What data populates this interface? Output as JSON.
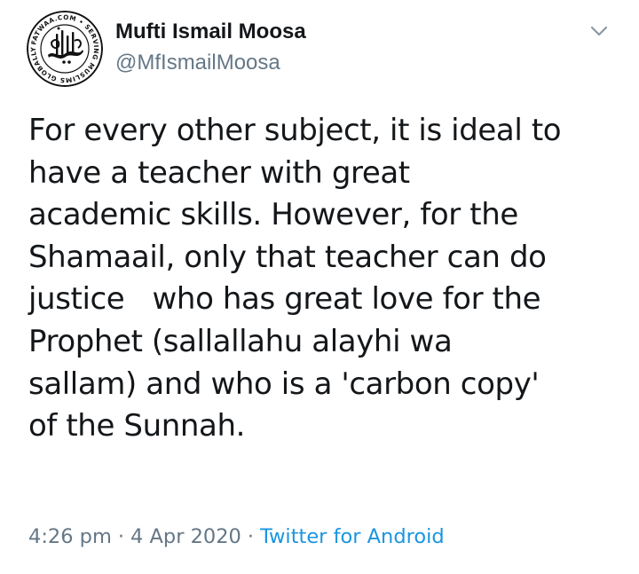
{
  "author": {
    "display_name": "Mufti Ismail Moosa",
    "handle": "@MfIsmailMoosa",
    "avatar_text": "FATWAA.COM • SERVING MUSLIMS GLOBALLY"
  },
  "tweet": {
    "text": "For every other subject, it is ideal to\nhave a teacher with great\nacademic skills. However, for the\nShamaail, only that teacher can do\njustice   who has great love for the\nProphet (sallallahu alayhi wa\nsallam) and who is a 'carbon copy'\nof the Sunnah."
  },
  "meta": {
    "time": "4:26 pm",
    "separator": "·",
    "date": "4 Apr 2020",
    "source": "Twitter for Android"
  },
  "icons": {
    "menu": "chevron-down-icon"
  },
  "colors": {
    "text_primary": "#14171a",
    "text_secondary": "#657786",
    "link": "#1b95e0",
    "avatar_dark": "#111111"
  }
}
